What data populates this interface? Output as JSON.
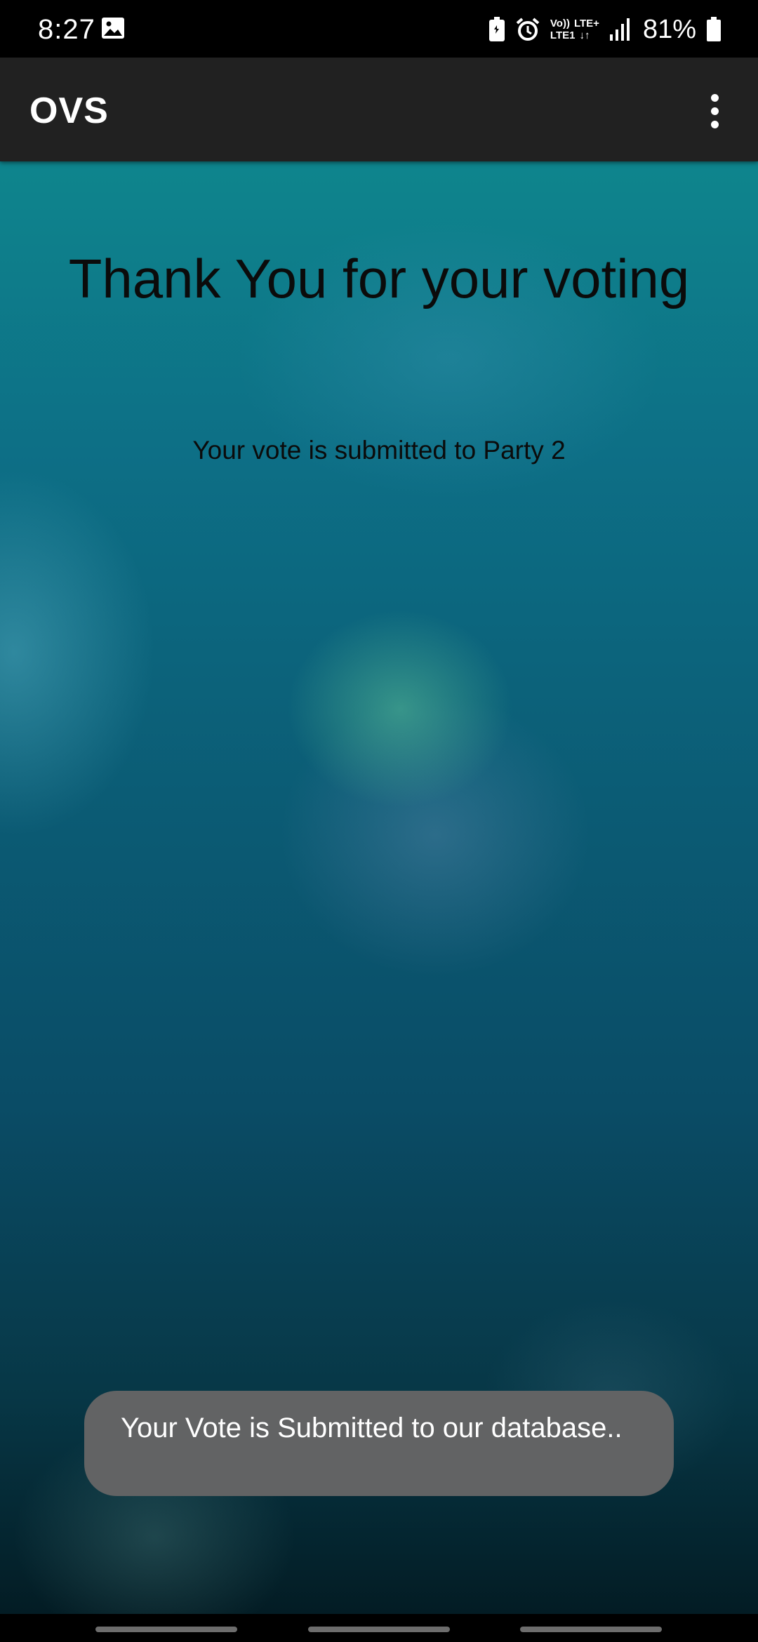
{
  "status_bar": {
    "time": "8:27",
    "network_top_left": "Vo))",
    "network_top_right": "LTE+",
    "network_bottom_left": "LTE1",
    "network_bottom_right": "↓↑",
    "battery": "81%"
  },
  "app_bar": {
    "title": "OVS"
  },
  "main": {
    "heading": "Thank You for your voting",
    "message": "Your vote is submitted to Party 2"
  },
  "toast": {
    "text": "Your Vote is Submitted to our database.."
  },
  "colors": {
    "app_bar": "#212121",
    "toast": "#626364",
    "text_dark": "#0b0b0b"
  }
}
